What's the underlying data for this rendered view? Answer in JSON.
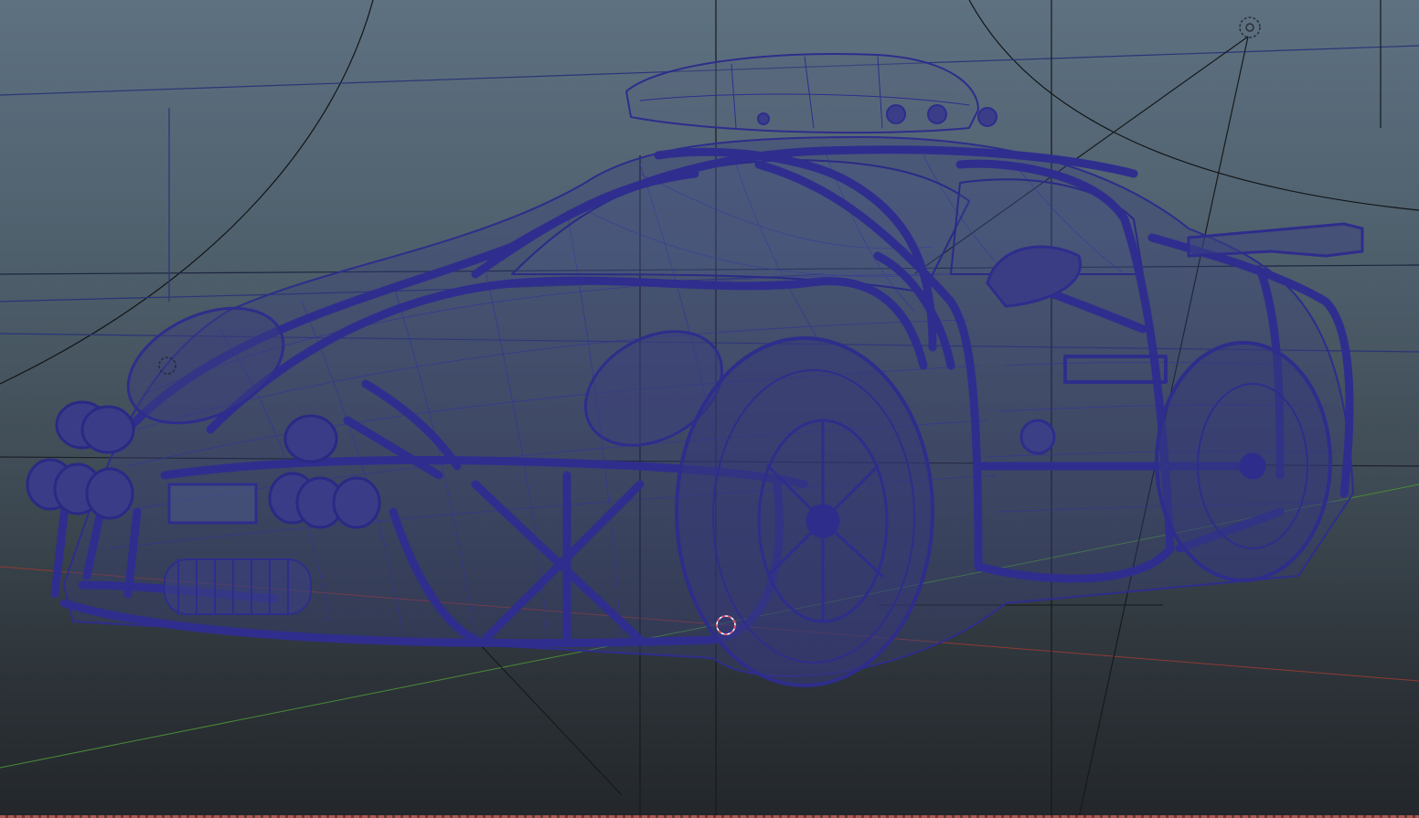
{
  "viewport": {
    "background_top": "#5e7181",
    "background_bottom": "#23272b",
    "wireframe_color": "#2e2d8c",
    "wireframe_highlight": "#4a47b0",
    "axis_x_color": "#9a3b35",
    "axis_z_color": "#4e8c3a",
    "camera_line_color": "#111416",
    "selection_marker_color": "#e05070"
  },
  "scene": {
    "object": "rally-car-wireframe",
    "icons": [
      "light-locator-icon",
      "pivot-marker-icon",
      "locator-icon"
    ]
  }
}
